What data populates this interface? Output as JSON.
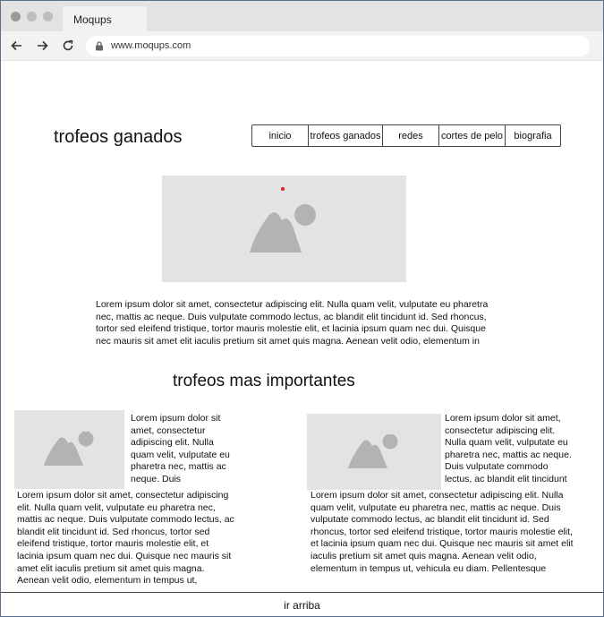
{
  "browser": {
    "tab_title": "Moqups",
    "url": "www.moqups.com"
  },
  "header": {
    "title": "trofeos ganados",
    "menu": [
      {
        "label": "inicio"
      },
      {
        "label": "trofeos ganados"
      },
      {
        "label": "redes"
      },
      {
        "label": "cortes de pelo"
      },
      {
        "label": "biografia"
      }
    ]
  },
  "main": {
    "intro_text": "Lorem ipsum dolor sit amet, consectetur adipiscing elit. Nulla quam velit, vulputate eu pharetra nec, mattis ac neque. Duis vulputate commodo lectus, ac blandit elit tincidunt id. Sed rhoncus, tortor sed eleifend tristique, tortor mauris molestie elit, et lacinia ipsum quam nec dui. Quisque nec mauris sit amet elit iaculis pretium sit amet quis magna. Aenean velit odio, elementum in",
    "section_title": "trofeos mas importantes",
    "cards": [
      {
        "side_text": "Lorem ipsum dolor sit amet, consectetur adipiscing elit. Nulla quam velit, vulputate eu pharetra nec, mattis ac neque. Duis",
        "body_text": "Lorem ipsum dolor sit amet, consectetur adipiscing elit. Nulla quam velit, vulputate eu pharetra nec, mattis ac neque. Duis vulputate commodo lectus, ac blandit elit tincidunt id. Sed rhoncus, tortor sed eleifend tristique, tortor mauris molestie elit, et lacinia ipsum quam nec dui. Quisque nec mauris sit amet elit iaculis pretium sit amet quis magna. Aenean velit odio, elementum in tempus ut,"
      },
      {
        "side_text": "Lorem ipsum dolor sit amet, consectetur adipiscing elit. Nulla quam velit, vulputate eu pharetra nec, mattis ac neque. Duis vulputate commodo lectus, ac blandit elit tincidunt",
        "body_text": "Lorem ipsum dolor sit amet, consectetur adipiscing elit. Nulla quam velit, vulputate eu pharetra nec, mattis ac neque. Duis vulputate commodo lectus, ac blandit elit tincidunt id. Sed rhoncus, tortor sed eleifend tristique, tortor mauris molestie elit, et lacinia ipsum quam nec dui. Quisque nec mauris sit amet elit iaculis pretium sit amet quis magna. Aenean velit odio, elementum in tempus ut, vehicula eu diam. Pellentesque"
      }
    ]
  },
  "footer": {
    "back_to_top": "ir arriba"
  },
  "icons": {
    "back": "arrow-left-icon",
    "forward": "arrow-right-icon",
    "reload": "reload-icon",
    "lock": "lock-icon",
    "image": "image-placeholder-icon"
  },
  "colors": {
    "placeholder_bg": "#e3e3e3",
    "placeholder_icon": "#b3b3b3",
    "border": "#444444"
  }
}
